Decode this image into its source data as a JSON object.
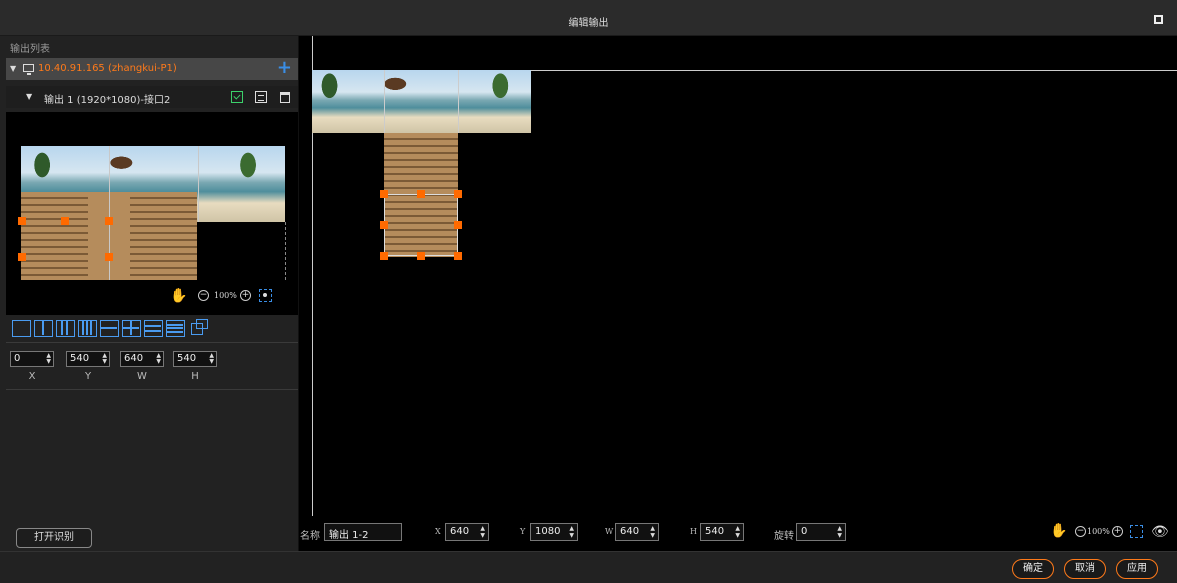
{
  "window": {
    "title": "编辑输出"
  },
  "sidebar": {
    "header": "输出列表",
    "device": {
      "label": "10.40.91.165  (zhangkui-P1)",
      "add_icon": "plus-icon"
    },
    "output": {
      "label": "输出 1 (1920*1080)-接口2"
    },
    "preview_zoom": {
      "percent": "100%"
    },
    "params": [
      {
        "value": "0",
        "label": "X"
      },
      {
        "value": "540",
        "label": "Y"
      },
      {
        "value": "640",
        "label": "W"
      },
      {
        "value": "540",
        "label": "H"
      }
    ],
    "recognize_button": "打开识别"
  },
  "canvas": {
    "name_label": "名称",
    "name_value": "输出 1-2",
    "x_label": "X",
    "x_value": "640",
    "y_label": "Y",
    "y_value": "1080",
    "w_label": "W",
    "w_value": "640",
    "h_label": "H",
    "h_value": "540",
    "rotate_label": "旋转",
    "rotate_value": "0",
    "zoom_percent": "100%"
  },
  "footer": {
    "ok": "确定",
    "cancel": "取消",
    "apply": "应用"
  },
  "colors": {
    "accent_orange": "#ff7a1a",
    "accent_blue": "#4a9bf0",
    "accent_green": "#3cd16b"
  }
}
